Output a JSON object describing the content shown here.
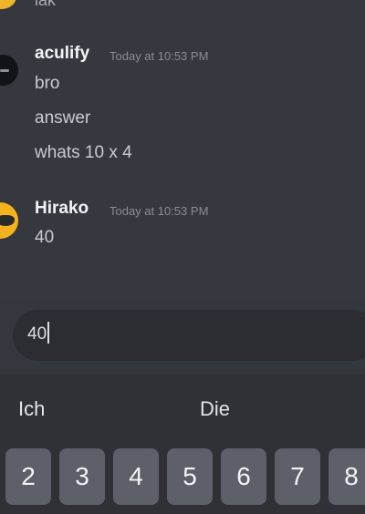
{
  "chat": {
    "partial_text": "lak",
    "messages": [
      {
        "author": "aculify",
        "time": "Today at 10:53 PM",
        "lines": [
          "bro",
          "answer",
          "whats 10 x 4"
        ]
      },
      {
        "author": "Hirako",
        "time": "Today at 10:53 PM",
        "lines": [
          "40"
        ]
      }
    ]
  },
  "composer": {
    "value": "40"
  },
  "keyboard": {
    "suggestions": [
      "Ich",
      "Die"
    ],
    "number_keys": [
      "2",
      "3",
      "4",
      "5",
      "6",
      "7",
      "8"
    ]
  },
  "colors": {
    "background": "#36383f",
    "input_bg": "#2b2d32",
    "key_bg": "#5d6068",
    "avatar_yellow": "#f4b31e"
  }
}
